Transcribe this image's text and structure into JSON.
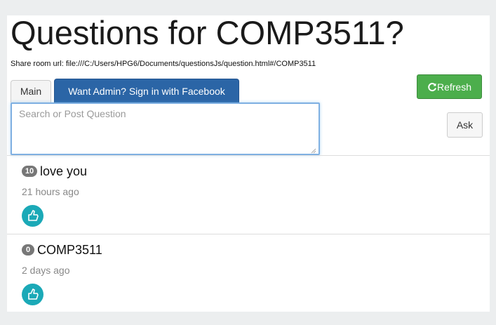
{
  "page": {
    "title": "Questions for COMP3511?",
    "share_label": "Share room url:",
    "share_url": "file:///C:/Users/HPG6/Documents/questionsJs/question.html#/COMP3511"
  },
  "tabs": {
    "main_label": "Main",
    "admin_label": "Want Admin? Sign in with Facebook"
  },
  "toolbar": {
    "refresh_label": "Refresh",
    "ask_label": "Ask"
  },
  "search": {
    "placeholder": "Search or Post Question",
    "value": ""
  },
  "questions": [
    {
      "votes": "10",
      "text": "love you",
      "time": "21 hours ago",
      "icon": "thumbs-up-icon"
    },
    {
      "votes": "0",
      "text": "COMP3511",
      "time": "2 days ago",
      "icon": "thumbs-up-icon"
    }
  ],
  "colors": {
    "refresh": "#4cae4c",
    "facebook": "#2b65a6",
    "like": "#1ba9b7",
    "badge": "#777777"
  }
}
